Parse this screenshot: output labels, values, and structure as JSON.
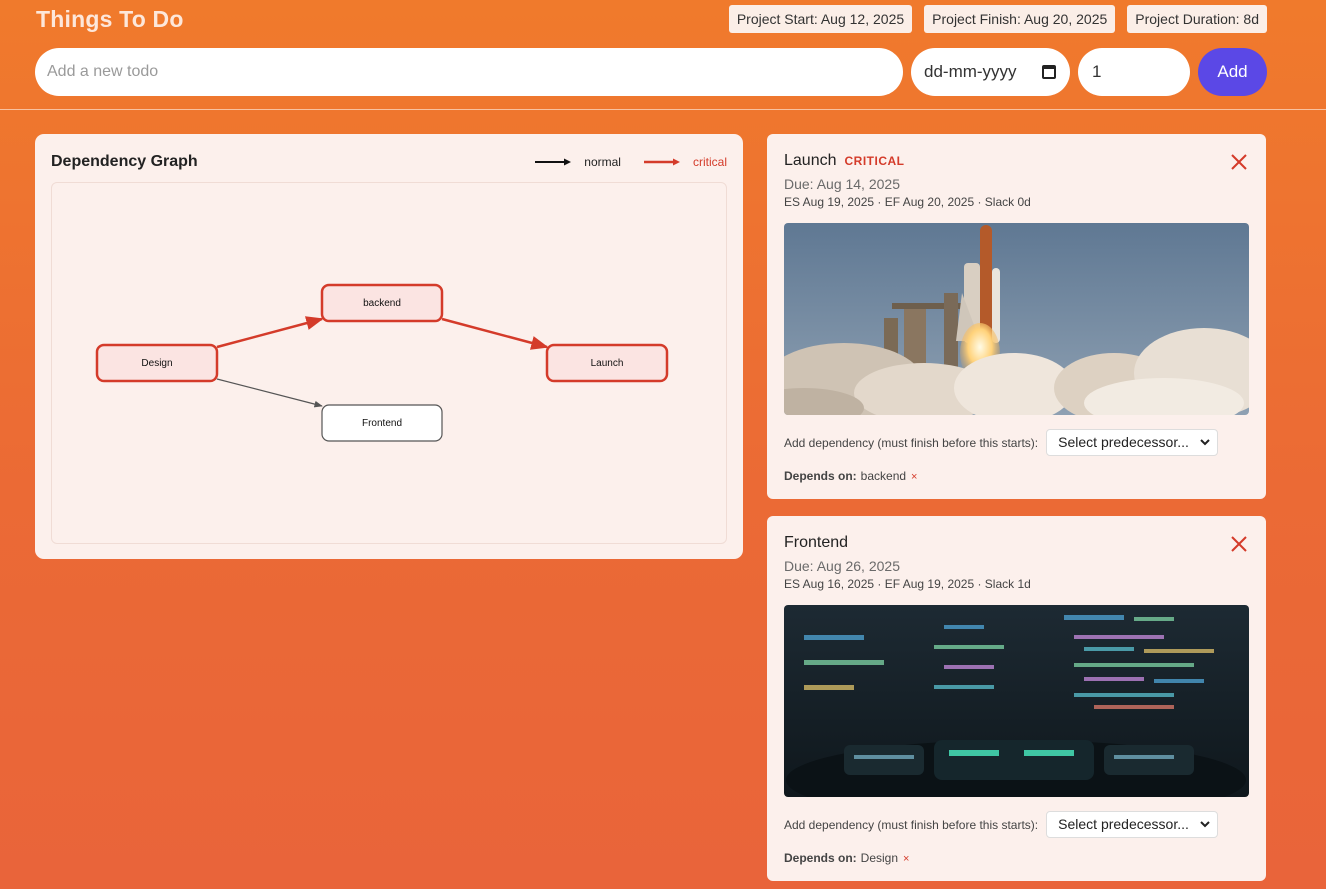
{
  "header": {
    "title": "Things To Do",
    "stats": {
      "start": "Project Start: Aug 12, 2025",
      "finish": "Project Finish: Aug 20, 2025",
      "duration": "Project Duration: 8d"
    },
    "todo_placeholder": "Add a new todo",
    "date_placeholder": "dd-mm-yyyy",
    "duration_value": "1",
    "add_label": "Add"
  },
  "graph": {
    "title": "Dependency Graph",
    "legend": {
      "normal": "normal",
      "critical": "critical"
    },
    "colors": {
      "critical": "#d43b2a",
      "critical_fill": "#fbe4e2",
      "normal": "#555555"
    },
    "nodes": [
      {
        "id": "design",
        "label": "Design",
        "critical": true
      },
      {
        "id": "backend",
        "label": "backend",
        "critical": true
      },
      {
        "id": "frontend",
        "label": "Frontend",
        "critical": false
      },
      {
        "id": "launch",
        "label": "Launch",
        "critical": true
      }
    ],
    "edges": [
      {
        "from": "Design",
        "to": "backend",
        "critical": true
      },
      {
        "from": "Design",
        "to": "Frontend",
        "critical": false
      },
      {
        "from": "backend",
        "to": "Launch",
        "critical": true
      }
    ]
  },
  "tasks": [
    {
      "name": "Launch",
      "badge": "CRITICAL",
      "due": "Due: Aug 14, 2025",
      "schedule": "ES Aug 19, 2025 · EF Aug 20, 2025 · Slack 0d",
      "image": "rocket-launch-photo",
      "dep_label": "Add dependency (must finish before this starts):",
      "select_value": "Select predecessor...",
      "depends_label": "Depends on:",
      "depends_on": "backend",
      "remove_symbol": "×"
    },
    {
      "name": "Frontend",
      "badge": "",
      "due": "Due: Aug 26, 2025",
      "schedule": "ES Aug 16, 2025 · EF Aug 19, 2025 · Slack 1d",
      "image": "code-screen-photo",
      "dep_label": "Add dependency (must finish before this starts):",
      "select_value": "Select predecessor...",
      "depends_label": "Depends on:",
      "depends_on": "Design",
      "remove_symbol": "×"
    }
  ]
}
